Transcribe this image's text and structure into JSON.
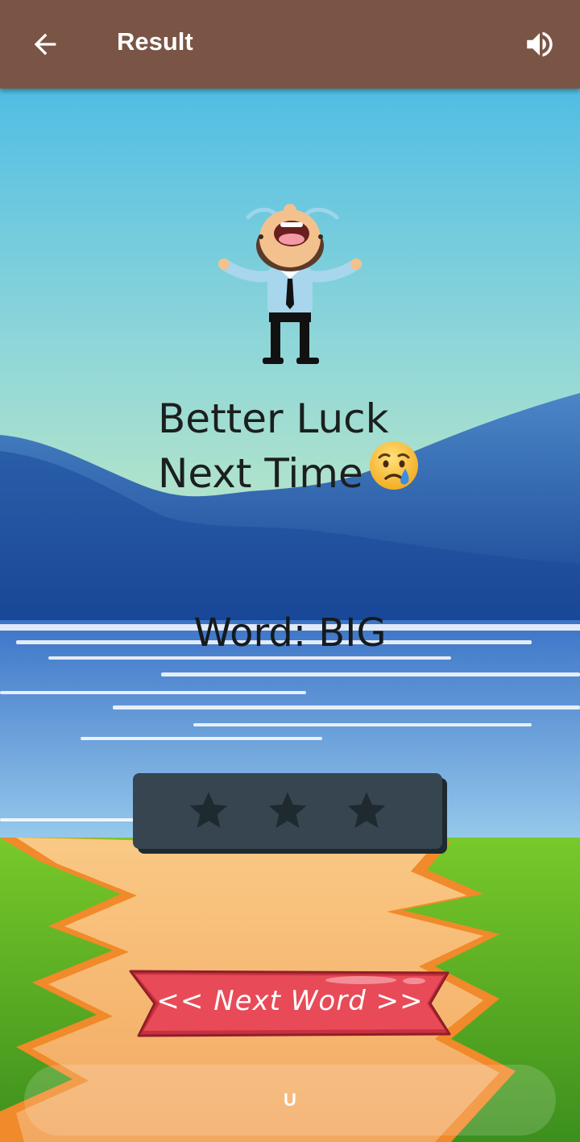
{
  "app_bar": {
    "title": "Result",
    "back_icon": "arrow-left-icon",
    "sound_icon": "volume-up-icon",
    "background_color": "#7a5445"
  },
  "result": {
    "message_line1": "Better Luck",
    "message_line2": "Next Time",
    "emoji": "crying-face-emoji",
    "word_label": "Word: BIG"
  },
  "rating": {
    "stars_earned": 0,
    "stars_total": 3
  },
  "next_button": {
    "label": "<<  Next Word  >>",
    "color": "#e84a57"
  },
  "bottom_bar": {
    "text": "U"
  }
}
